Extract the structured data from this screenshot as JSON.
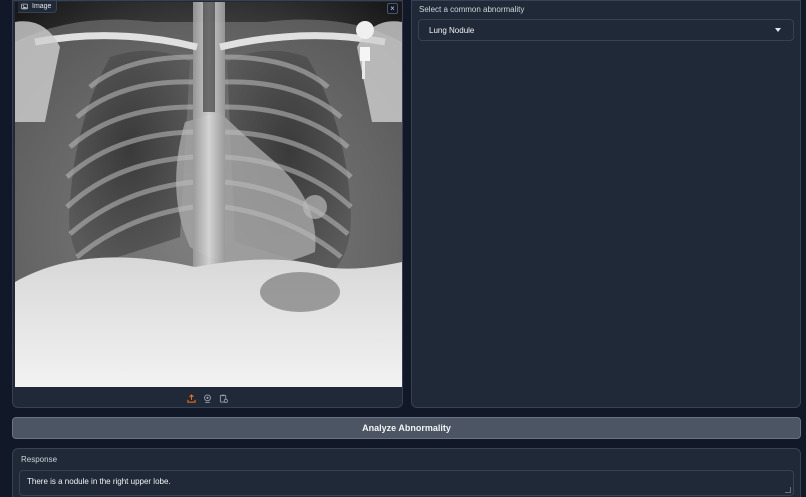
{
  "image_panel": {
    "label": "Image",
    "label_icon": "image-icon",
    "close_icon": "close-icon",
    "close_glyph": "×",
    "toolbar": [
      "upload-icon",
      "webcam-icon",
      "clipboard-icon"
    ],
    "accent": "#f97316"
  },
  "select": {
    "label": "Select a common abnormality",
    "value": "Lung Nodule"
  },
  "analyze_button": {
    "label": "Analyze Abnormality"
  },
  "response": {
    "label": "Response",
    "text": "There is a nodule in the right upper lobe."
  },
  "colors": {
    "background": "#111827",
    "panel": "#1f2937",
    "border": "#374151",
    "button": "#4b5563"
  }
}
